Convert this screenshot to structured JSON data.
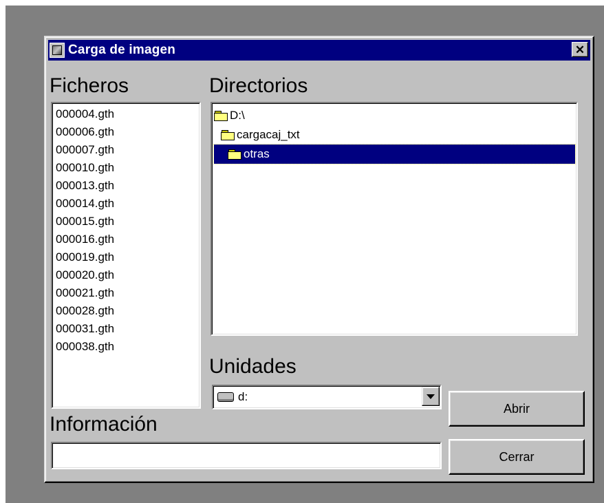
{
  "window": {
    "title": "Carga de imagen",
    "close_label": "✕"
  },
  "labels": {
    "files": "Ficheros",
    "directories": "Directorios",
    "drives": "Unidades",
    "info": "Información"
  },
  "files": [
    "000004.gth",
    "000006.gth",
    "000007.gth",
    "000010.gth",
    "000013.gth",
    "000014.gth",
    "000015.gth",
    "000016.gth",
    "000019.gth",
    "000020.gth",
    "000021.gth",
    "000028.gth",
    "000031.gth",
    "000038.gth"
  ],
  "directories": [
    {
      "label": "D:\\",
      "icon": "folder-open-icon",
      "selected": false
    },
    {
      "label": "cargacaj_txt",
      "icon": "folder-open-icon",
      "selected": false
    },
    {
      "label": "otras",
      "icon": "folder-open-icon",
      "selected": true
    }
  ],
  "drive": {
    "value": "d:",
    "icon": "hard-drive-icon"
  },
  "info_field": {
    "value": ""
  },
  "buttons": {
    "open": "Abrir",
    "close": "Cerrar"
  },
  "colors": {
    "titlebar": "#000080",
    "face": "#c0c0c0",
    "desktop": "#808080",
    "selection": "#000080"
  }
}
